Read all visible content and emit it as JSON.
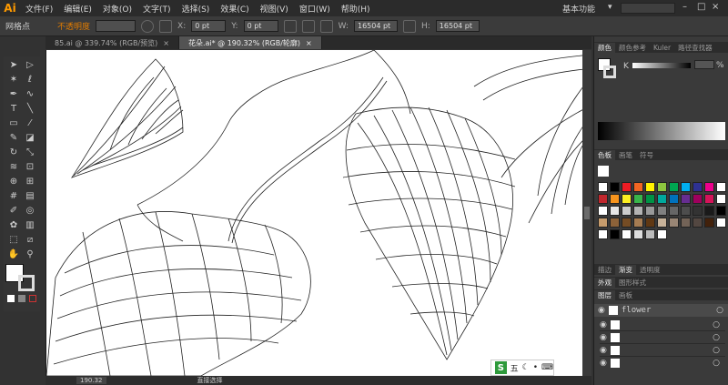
{
  "app": {
    "logo": "Ai",
    "workspace": "基本功能",
    "search_placeholder": ""
  },
  "menu": [
    "文件(F)",
    "编辑(E)",
    "对象(O)",
    "文字(T)",
    "选择(S)",
    "效果(C)",
    "视图(V)",
    "窗口(W)",
    "帮助(H)"
  ],
  "control_bar": {
    "selection_label": "网格点",
    "opacity_label": "不透明度",
    "x_value": "0 pt",
    "y_value": "0 pt",
    "w_value": "16504 pt",
    "h_value": "16504 pt"
  },
  "doc_tabs": [
    {
      "label": "85.ai @ 339.74% (RGB/预览)"
    },
    {
      "label": "花朵.ai* @ 190.32% (RGB/轮廓)"
    }
  ],
  "status": {
    "zoom": "190.32",
    "tool": "直接选择"
  },
  "color_panel": {
    "tabs": [
      "颜色",
      "颜色参考",
      "Kuler",
      "路径查找器"
    ],
    "k_label": "K",
    "k_value": "%"
  },
  "swatches_panel": {
    "tabs": [
      "色板",
      "画笔",
      "符号"
    ]
  },
  "misc_tabs": [
    "描边",
    "渐变",
    "透明度"
  ],
  "misc_tabs2": [
    "外观",
    "图形样式"
  ],
  "layers_panel": {
    "tabs": [
      "图层",
      "画板"
    ],
    "layers": [
      {
        "name": "flower"
      }
    ]
  },
  "swatch_colors": [
    [
      "#ffffff",
      "#000000",
      "#ed1c24",
      "#f26522",
      "#fff200",
      "#8dc63f",
      "#00a651",
      "#00aeef",
      "#2e3192",
      "#ec008c",
      "#ffffff"
    ],
    [
      "#c1272d",
      "#f7941d",
      "#fcee21",
      "#39b54a",
      "#009245",
      "#00a99d",
      "#0071bc",
      "#662d91",
      "#9e005d",
      "#d4145a",
      "#ffffff"
    ],
    [
      "#ffffff",
      "#e6e6e6",
      "#cccccc",
      "#b3b3b3",
      "#999999",
      "#808080",
      "#666666",
      "#4d4d4d",
      "#333333",
      "#1a1a1a",
      "#000000"
    ],
    [
      "#c69c6d",
      "#8c6239",
      "#754c24",
      "#a67c52",
      "#603813",
      "#c7b299",
      "#998675",
      "#736357",
      "#534741",
      "#42210b",
      "#ffffff"
    ],
    [
      "#ffffff",
      "#000000",
      "#ffffff",
      "#dddddd",
      "#bbbbbb",
      "#ffffff",
      "",
      "",
      "",
      "",
      ""
    ]
  ],
  "colors": {
    "accent": "#e07b00",
    "ui_dark": "#2b2b2b",
    "panel": "#3a3a3a"
  }
}
